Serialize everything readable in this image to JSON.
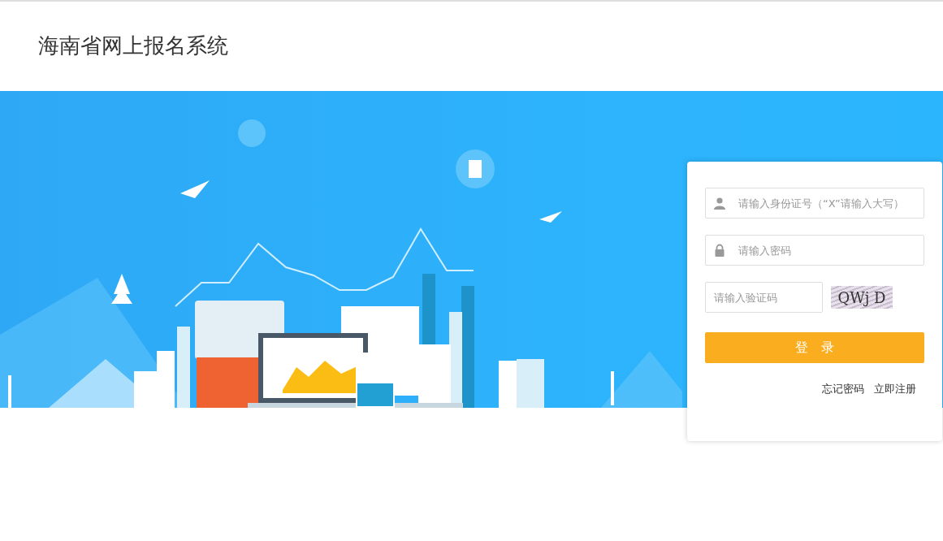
{
  "header": {
    "title": "海南省网上报名系统"
  },
  "login": {
    "fields": [
      {
        "kind": "id",
        "placeholder": "请输入身份证号（“X”请输入大写）"
      },
      {
        "kind": "password",
        "placeholder": "请输入密码"
      }
    ],
    "captcha_field": {
      "placeholder": "请输入验证码"
    },
    "captcha": {
      "text": "QWj D"
    },
    "submit": {
      "label": "登　录"
    },
    "links": [
      "忘记密码",
      "立即注册"
    ]
  }
}
